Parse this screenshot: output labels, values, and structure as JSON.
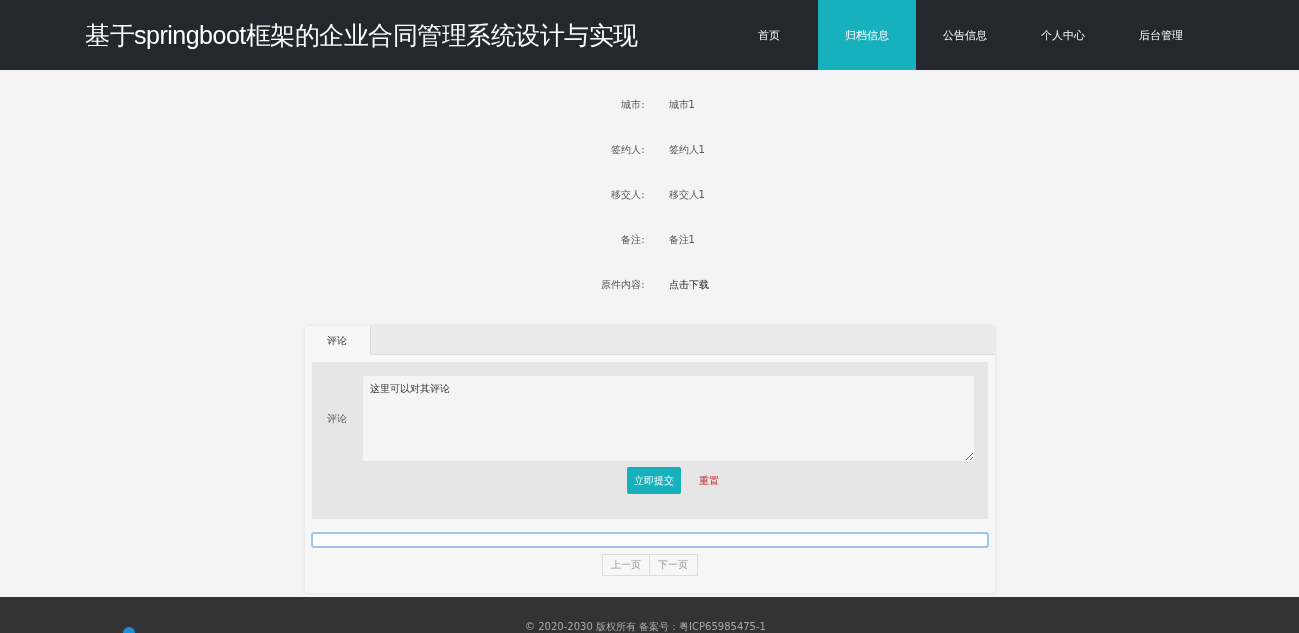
{
  "header": {
    "title": "基于springboot框架的企业合同管理系统设计与实现",
    "nav": [
      {
        "label": "首页",
        "selected": false
      },
      {
        "label": "归档信息",
        "selected": true
      },
      {
        "label": "公告信息",
        "selected": false
      },
      {
        "label": "个人中心",
        "selected": false
      },
      {
        "label": "后台管理",
        "selected": false
      }
    ]
  },
  "details": [
    {
      "label": "城市:",
      "value": "城市1",
      "kind": "text"
    },
    {
      "label": "签约人:",
      "value": "签约人1",
      "kind": "text"
    },
    {
      "label": "移交人:",
      "value": "移交人1",
      "kind": "text"
    },
    {
      "label": "备注:",
      "value": "备注1",
      "kind": "text"
    },
    {
      "label": "原件内容:",
      "value": "点击下载",
      "kind": "link"
    }
  ],
  "comments": {
    "tabs": [
      {
        "label": "评论",
        "selected": true
      }
    ],
    "form": {
      "label": "评论",
      "value": "这里可以对其评论",
      "submit": "立即提交",
      "reset": "重置"
    },
    "list_box": {
      "focused": true
    },
    "pagination": [
      {
        "label": "上一页",
        "disabled": true
      },
      {
        "label": "下一页",
        "disabled": true
      }
    ]
  },
  "footer": {
    "text": "© 2020-2030 版权所有 备案号：粤ICP65985475-1"
  }
}
